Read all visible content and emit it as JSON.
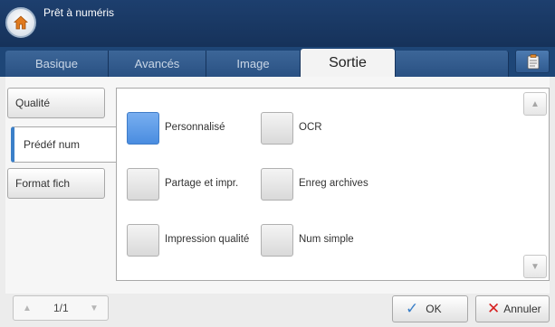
{
  "header": {
    "title": "Prêt à numéris"
  },
  "tabs": [
    {
      "label": "Basique",
      "active": false
    },
    {
      "label": "Avancés",
      "active": false
    },
    {
      "label": "Image",
      "active": false
    },
    {
      "label": "Sortie",
      "active": true
    }
  ],
  "sidebar": {
    "items": [
      {
        "label": "Qualité",
        "active": false
      },
      {
        "label": "Prédéf num",
        "active": true
      },
      {
        "label": "Format fich",
        "active": false
      }
    ]
  },
  "options": [
    {
      "label": "Personnalisé",
      "selected": true
    },
    {
      "label": "OCR",
      "selected": false
    },
    {
      "label": "Partage et impr.",
      "selected": false
    },
    {
      "label": "Enreg archives",
      "selected": false
    },
    {
      "label": "Impression qualité",
      "selected": false
    },
    {
      "label": "Num simple",
      "selected": false
    }
  ],
  "pager": {
    "page": "1/1"
  },
  "footer": {
    "ok_label": "OK",
    "cancel_label": "Annuler"
  },
  "colors": {
    "header": "#16325a",
    "tab_bar": "#1e4677",
    "accent": "#3a7fc8",
    "selected": "#4a8de0",
    "cancel_x": "#d62020",
    "ok_check": "#3a7fc8"
  }
}
